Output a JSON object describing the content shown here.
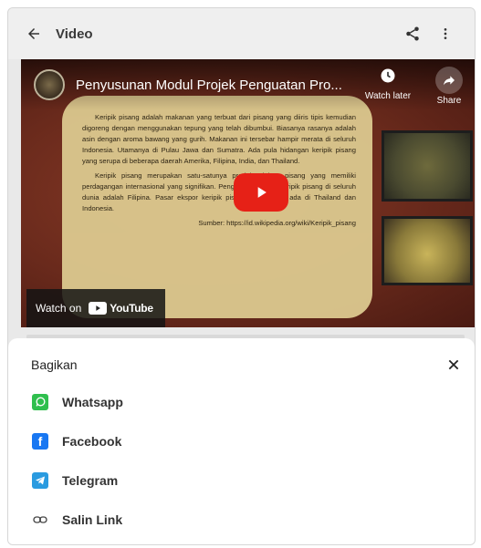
{
  "appbar": {
    "title": "Video"
  },
  "video": {
    "title": "Penyusunan Modul Projek Penguatan Pro...",
    "watch_later_label": "Watch later",
    "share_label": "Share",
    "watch_on_label": "Watch on",
    "youtube_label": "YouTube",
    "slide_paragraph_1": "Keripik pisang adalah makanan yang terbuat dari pisang yang diiris tipis kemudian digoreng dengan menggunakan tepung yang telah dibumbui. Biasanya rasanya adalah asin dengan aroma bawang yang gurih. Makanan ini tersebar hampir merata di seluruh Indonesia. Utamanya di Pulau Jawa dan Sumatra. Ada pula hidangan keripik pisang yang serupa di beberapa daerah Amerika, Filipina, India, dan Thailand.",
    "slide_paragraph_2": "Keripik pisang merupakan satu-satunya produk olahan pisang yang memiliki perdagangan internasional yang signifikan. Pengekspor utama keripik pisang di seluruh dunia adalah Filipina. Pasar ekspor keripik pisang juga sudah ada di Thailand dan Indonesia.",
    "slide_source": "Sumber: https://id.wikipedia.org/wiki/Keripik_pisang"
  },
  "share_sheet": {
    "title": "Bagikan",
    "items": [
      {
        "label": "Whatsapp",
        "icon": "whatsapp-icon"
      },
      {
        "label": "Facebook",
        "icon": "facebook-icon"
      },
      {
        "label": "Telegram",
        "icon": "telegram-icon"
      },
      {
        "label": "Salin Link",
        "icon": "link-icon"
      }
    ]
  },
  "colors": {
    "whatsapp": "#2fbf4e",
    "facebook": "#1877f2",
    "telegram": "#2a9be0",
    "youtube_red": "#e62117"
  }
}
